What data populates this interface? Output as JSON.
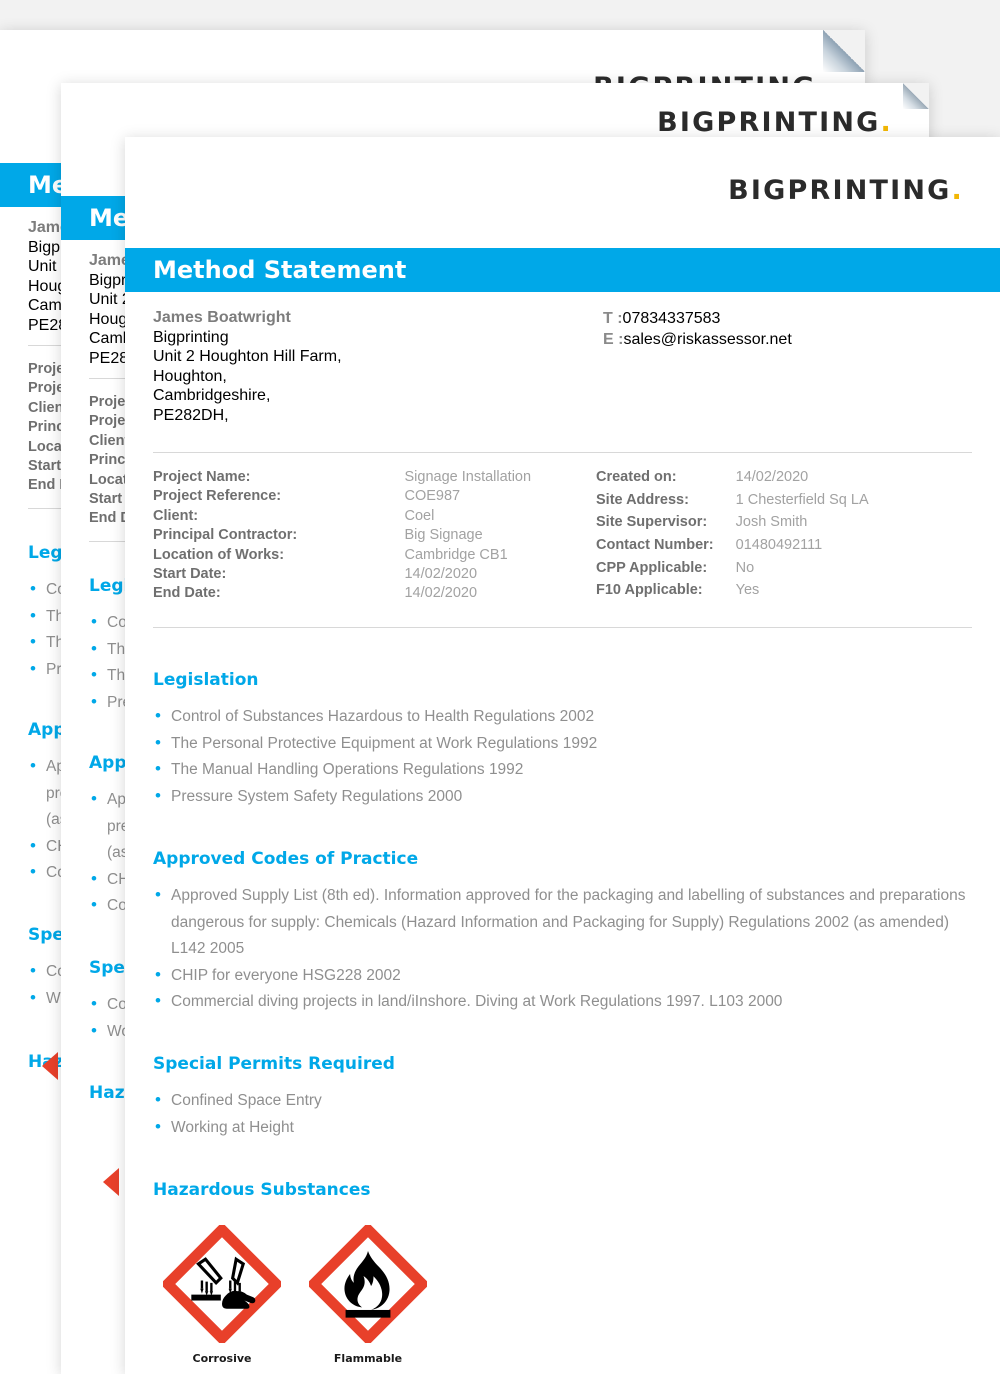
{
  "brand": {
    "logo_text": "BIGPRINTING",
    "logo_dot": ".",
    "accent_blue": "#00a8e8",
    "accent_yellow": "#f2b705",
    "hazard_red": "#e8402a"
  },
  "document": {
    "title": "Method Statement"
  },
  "contact": {
    "name": "James Boatwright",
    "company": "Bigprinting",
    "address_line1": "Unit 2 Houghton Hill Farm,",
    "address_line2": "Houghton,",
    "address_line3": "Cambridgeshire,",
    "postcode": "PE282DH,",
    "phone_label": "T :",
    "phone_value": "07834337583",
    "email_label": "E :",
    "email_value": "sales@riskassessor.net"
  },
  "details": {
    "left": [
      {
        "key": "Project Name:",
        "value": "Signage Installation"
      },
      {
        "key": "Project Reference:",
        "value": "COE987"
      },
      {
        "key": "Client:",
        "value": "Coel"
      },
      {
        "key": "Principal Contractor:",
        "value": "Big Signage"
      },
      {
        "key": "Location of Works:",
        "value": "Cambridge CB1"
      },
      {
        "key": "Start Date:",
        "value": "14/02/2020"
      },
      {
        "key": "End Date:",
        "value": "14/02/2020"
      }
    ],
    "right": [
      {
        "key": "Created on:",
        "value": "14/02/2020"
      },
      {
        "key": "Site Address:",
        "value": "1 Chesterfield Sq LA"
      },
      {
        "key": "Site Supervisor:",
        "value": "Josh Smith"
      },
      {
        "key": "Contact Number:",
        "value": "01480492111"
      },
      {
        "key": "CPP Applicable:",
        "value": "No"
      },
      {
        "key": "F10 Applicable:",
        "value": "Yes"
      }
    ]
  },
  "sections": {
    "legislation": {
      "heading": "Legislation",
      "items": [
        "Control of Substances Hazardous to Health Regulations 2002",
        "The Personal Protective Equipment at Work Regulations 1992",
        "The Manual Handling Operations Regulations 1992",
        "Pressure System Safety Regulations 2000"
      ]
    },
    "approved_codes": {
      "heading": "Approved Codes of Practice",
      "items": [
        "Approved Supply List (8th ed). Information approved for the packaging and labelling of substances and preparations dangerous for supply: Chemicals (Hazard Information and Packaging for Supply) Regulations 2002 (as amended) L142 2005",
        "CHIP for everyone HSG228 2002",
        "Commercial diving projects in land/iInshore. Diving at Work Regulations 1997. L103 2000"
      ]
    },
    "special_permits": {
      "heading": "Special Permits Required",
      "items": [
        "Confined Space Entry",
        "Working at Height"
      ]
    },
    "hazardous_substances": {
      "heading": "Hazardous Substances",
      "pictograms": [
        {
          "icon": "ghs-corrosive-icon",
          "label": "Corrosive"
        },
        {
          "icon": "ghs-flammable-icon",
          "label": "Flammable"
        }
      ]
    }
  }
}
